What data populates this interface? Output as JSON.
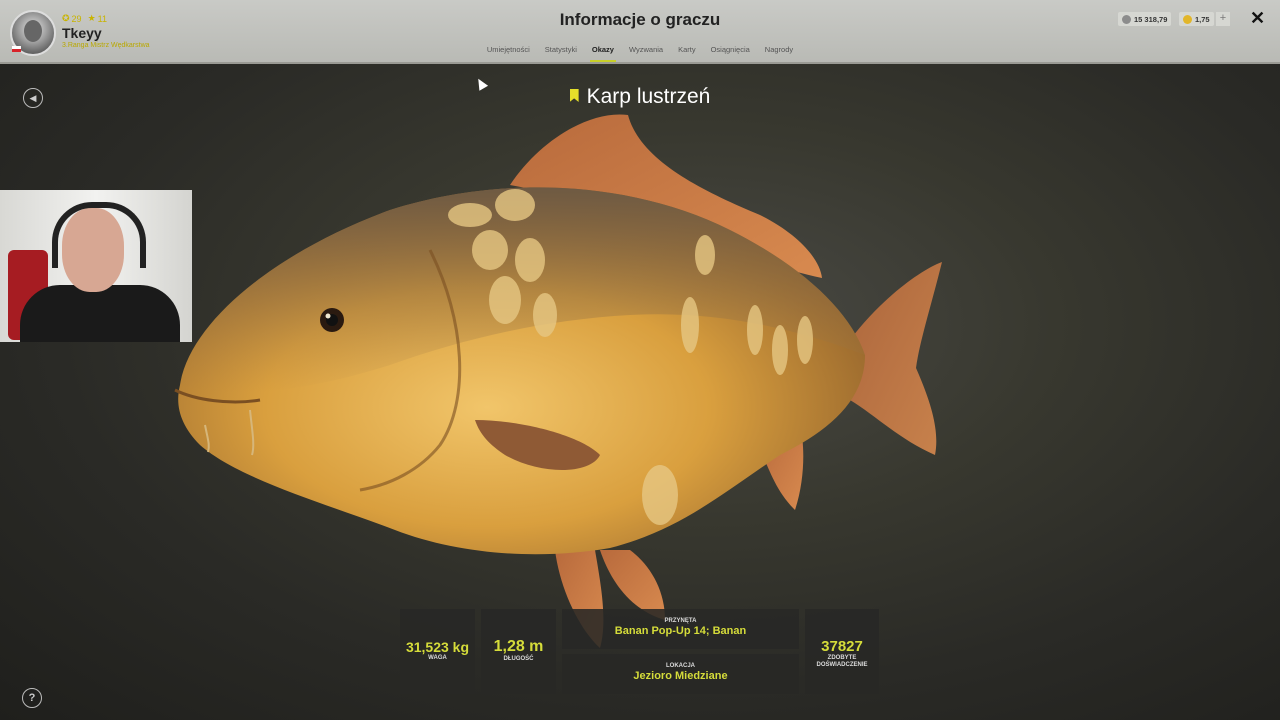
{
  "header": {
    "title": "Informacje o graczu",
    "player": {
      "name": "Tkeyy",
      "rank": "3.Ranga Mistrz Wędkarstwa",
      "level": "29",
      "stars": "11"
    },
    "tabs": [
      {
        "label": "Umiejętności",
        "active": false
      },
      {
        "label": "Statystyki",
        "active": false
      },
      {
        "label": "Okazy",
        "active": true
      },
      {
        "label": "Wyzwania",
        "active": false
      },
      {
        "label": "Karty",
        "active": false
      },
      {
        "label": "Osiągnięcia",
        "active": false
      },
      {
        "label": "Nagrody",
        "active": false
      }
    ],
    "currency": {
      "silver": "15 318,79",
      "gold": "1,75",
      "add": "+"
    },
    "close": "✕"
  },
  "fish": {
    "name": "Karp lustrzeń"
  },
  "stats": {
    "weight": {
      "value": "31,523 kg",
      "label": "WAGA"
    },
    "length": {
      "value": "1,28 m",
      "label": "DŁUGOŚĆ"
    },
    "bait": {
      "label": "PRZYNĘTA",
      "value": "Banan Pop-Up 14; Banan"
    },
    "location": {
      "label": "LOKACJA",
      "value": "Jezioro Miedziane"
    },
    "experience": {
      "value": "37827",
      "label1": "ZDOBYTE",
      "label2": "DOŚWIADCZENIE"
    }
  },
  "controls": {
    "help": "?",
    "back": "◀"
  },
  "colors": {
    "accent": "#d5dc3a",
    "bookmark": "#e5e02a"
  }
}
